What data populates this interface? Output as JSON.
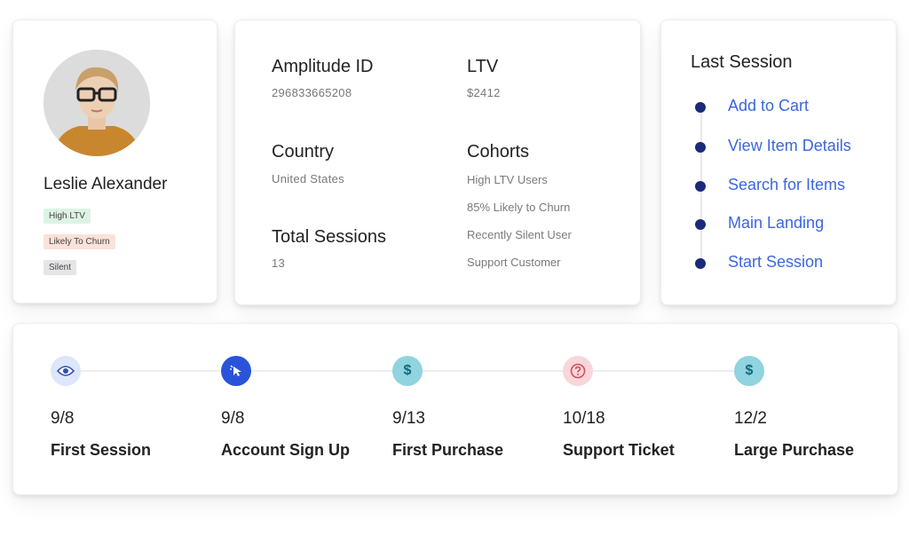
{
  "profile": {
    "name": "Leslie Alexander",
    "tags": [
      "High LTV",
      "Likely To Churn",
      "Silent"
    ]
  },
  "details": {
    "fields": [
      {
        "label": "Amplitude ID",
        "value": "296833665208"
      },
      {
        "label": "LTV",
        "value": "$2412"
      },
      {
        "label": "Country",
        "value": "United States"
      },
      {
        "label": "Total Sessions",
        "value": "13"
      }
    ],
    "cohorts_label": "Cohorts",
    "cohorts": [
      "High LTV Users",
      "85% Likely to Churn",
      "Recently Silent User",
      "Support Customer"
    ]
  },
  "last_session": {
    "title": "Last Session",
    "items": [
      "Add to Cart",
      "View Item Details",
      "Search for Items",
      "Main Landing",
      "Start Session"
    ]
  },
  "timeline": {
    "events": [
      {
        "date": "9/8",
        "label": "First Session",
        "icon": "eye-icon"
      },
      {
        "date": "9/8",
        "label": "Account Sign Up",
        "icon": "cursor-click-icon"
      },
      {
        "date": "9/13",
        "label": "First Purchase",
        "icon": "dollar-icon"
      },
      {
        "date": "10/18",
        "label": "Support Ticket",
        "icon": "help-icon"
      },
      {
        "date": "12/2",
        "label": "Large Purchase",
        "icon": "dollar-icon"
      }
    ]
  },
  "colors": {
    "link": "#3b66e0",
    "dot": "#1b2a7a",
    "tag_green": "#dcf3e4",
    "tag_orange": "#fbe2d8",
    "tag_gray": "#e4e5e7"
  }
}
